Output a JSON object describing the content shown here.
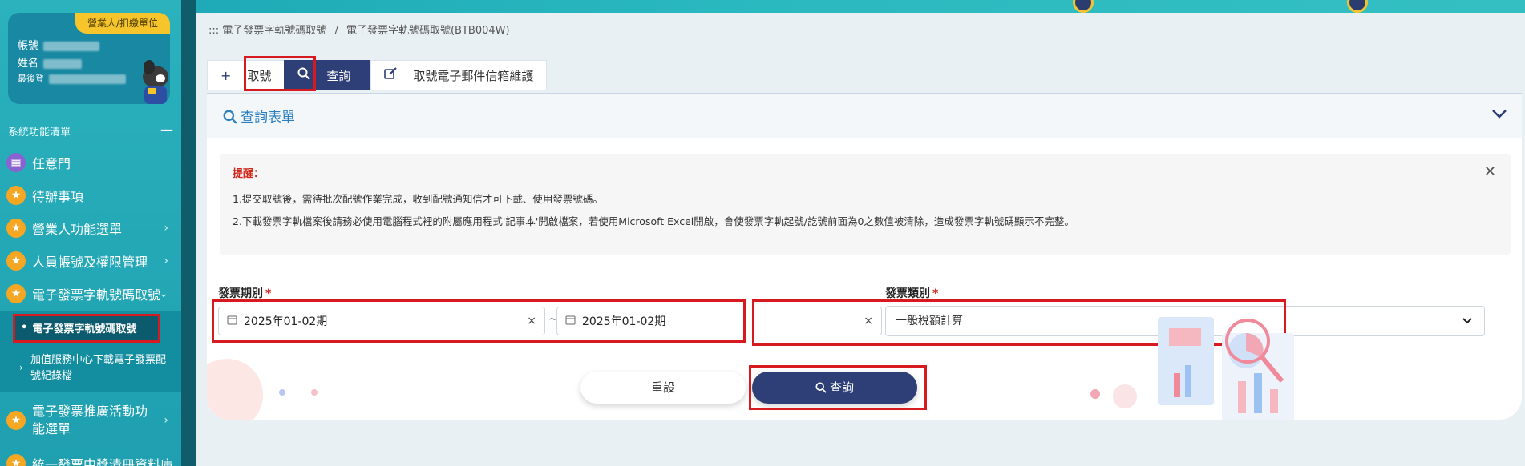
{
  "sidebar": {
    "profile": {
      "tag": "營業人/扣繳單位",
      "account_label": "帳號",
      "name_label": "姓名",
      "last_login_label": "最後登"
    },
    "menu_title": "系統功能清單",
    "collapse_symbol": "—",
    "items": [
      {
        "label": "任意門",
        "icon": "map-icon"
      },
      {
        "label": "待辦事項",
        "icon": "star-icon"
      },
      {
        "label": "營業人功能選單",
        "icon": "star-icon"
      },
      {
        "label": "人員帳號及權限管理",
        "icon": "star-icon"
      },
      {
        "label": "電子發票字軌號碼取號",
        "icon": "star-icon"
      }
    ],
    "submenu": {
      "active": "電子發票字軌號碼取號",
      "other": "加值服務中心下載電子發票配號紀錄檔"
    },
    "more_items": [
      {
        "label": "電子發票推廣活動功能選單",
        "icon": "star-icon"
      },
      {
        "label": "統一發票中獎清冊資料庫",
        "icon": "star-icon"
      }
    ]
  },
  "breadcrumb": {
    "prefix": ":::",
    "parent": "電子發票字軌號碼取號",
    "sep": "/",
    "current": "電子發票字軌號碼取號(BTB004W)"
  },
  "tabs": [
    {
      "label": "取號",
      "icon": "plus-icon"
    },
    {
      "label": "查詢",
      "icon": "search-icon"
    },
    {
      "label": "取號電子郵件信箱維護",
      "icon": "edit-icon"
    }
  ],
  "form": {
    "title": "查詢表單",
    "notice": {
      "title": "提醒：",
      "line1": "1.提交取號後，需待批次配號作業完成，收到配號通知信才可下載、使用發票號碼。",
      "line2": "2.下載發票字軌檔案後請務必使用電腦程式裡的附屬應用程式'記事本'開啟檔案，若使用Microsoft Excel開啟，會使發票字軌起號/訖號前面為0之數值被清除，造成發票字軌號碼顯示不完整。",
      "close": "✕"
    },
    "period_label": "發票期別",
    "period_from": "2025年01-02期",
    "period_to": "2025年01-02期",
    "range_sep": "~",
    "clear_symbol": "×",
    "type_label": "發票類別",
    "type_value": "一般稅額計算",
    "required_mark": "*",
    "reset_button": "重設",
    "query_button": "查詢"
  },
  "colors": {
    "accent": "#2e3f78",
    "highlight": "#d71920",
    "sidebar": "#2bb2bd"
  }
}
